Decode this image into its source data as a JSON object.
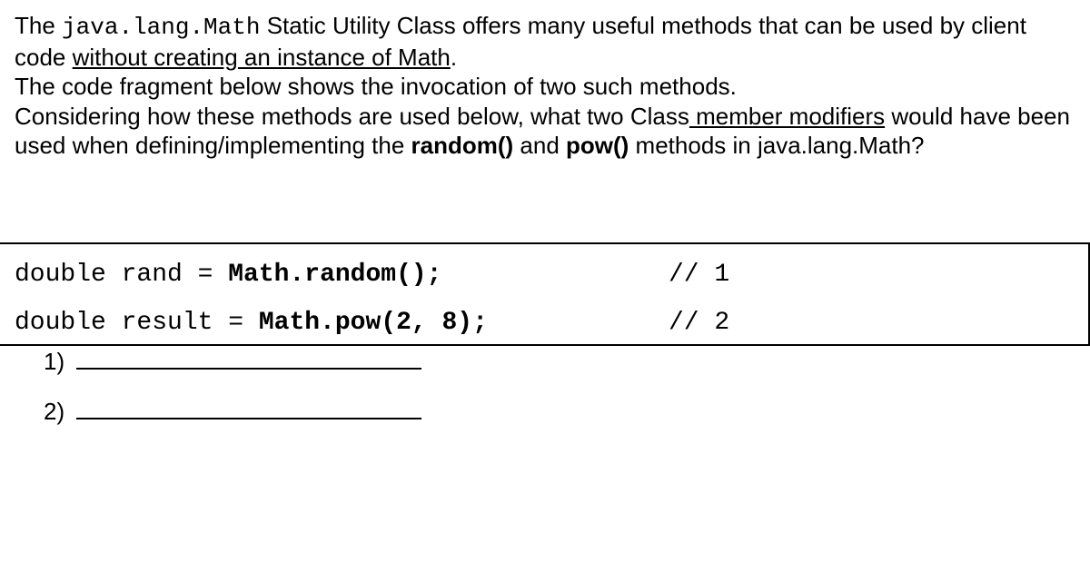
{
  "question": {
    "p1_a": "The ",
    "p1_code": "java.lang.Math",
    "p1_b": "  Static Utility Class offers many useful methods that can be used by client code ",
    "p1_underline": "without creating an instance of Math",
    "p1_c": ".",
    "p2": "The code fragment below shows the invocation of two such methods.",
    "p3_a": "Considering how these methods are used below, what two Class",
    "p3_under1": " member modifiers",
    "p3_b": " would have been used when defining/implementing the ",
    "p3_bold1": "random()",
    "p3_c": "  and ",
    "p3_bold2": "pow()",
    "p3_d": " methods in java.lang.Math?"
  },
  "code": {
    "line1_a": "double rand = ",
    "line1_b": "Math.random();",
    "line1_comment": "// 1",
    "line2_a": "double result = ",
    "line2_b": "Math.pow(2, 8);",
    "line2_comment": "// 2"
  },
  "answers": {
    "label1": "1)",
    "label2": "2)"
  }
}
